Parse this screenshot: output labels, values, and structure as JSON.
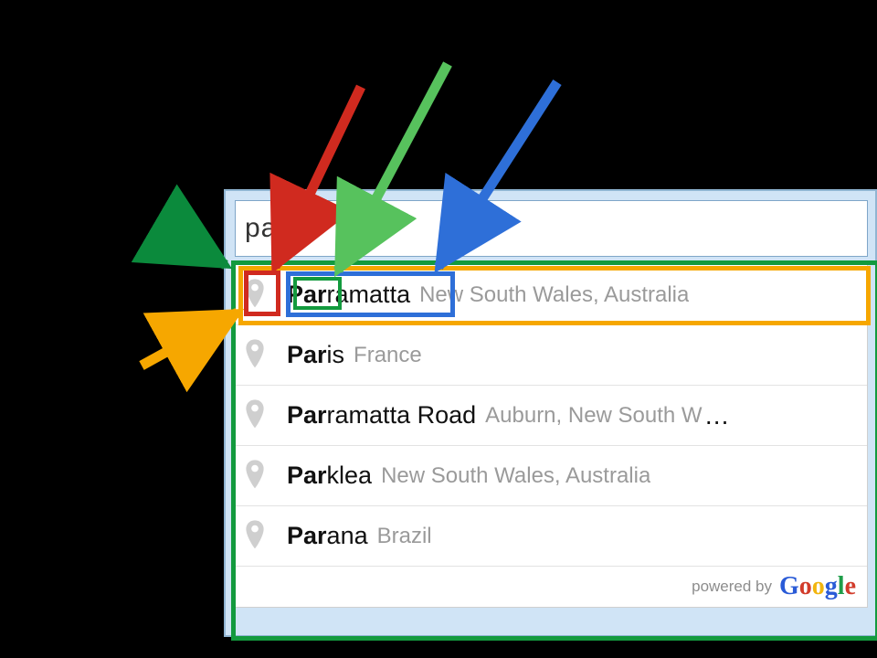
{
  "search": {
    "value": "par"
  },
  "suggestions": [
    {
      "match": "Par",
      "rest": "ramatta",
      "secondary": "New South Wales, Australia",
      "truncated": false
    },
    {
      "match": "Par",
      "rest": "is",
      "secondary": "France",
      "truncated": false
    },
    {
      "match": "Par",
      "rest": "ramatta Road",
      "secondary": "Auburn, New South W",
      "truncated": true
    },
    {
      "match": "Par",
      "rest": "klea",
      "secondary": "New South Wales, Australia",
      "truncated": false
    },
    {
      "match": "Par",
      "rest": "ana",
      "secondary": "Brazil",
      "truncated": false
    }
  ],
  "attribution": {
    "prefix": "powered by"
  },
  "annotations": {
    "arrow_colors": {
      "dark_green": "#0b8a3c",
      "orange": "#f6a700",
      "red": "#d02a1f",
      "light_green": "#57c25d",
      "blue": "#2e6fd8"
    },
    "box_colors": {
      "dropdown": "#139a3e",
      "row": "#f6a700",
      "icon": "#d02a1f",
      "term": "#2e6fd8",
      "match": "#139a3e"
    }
  }
}
